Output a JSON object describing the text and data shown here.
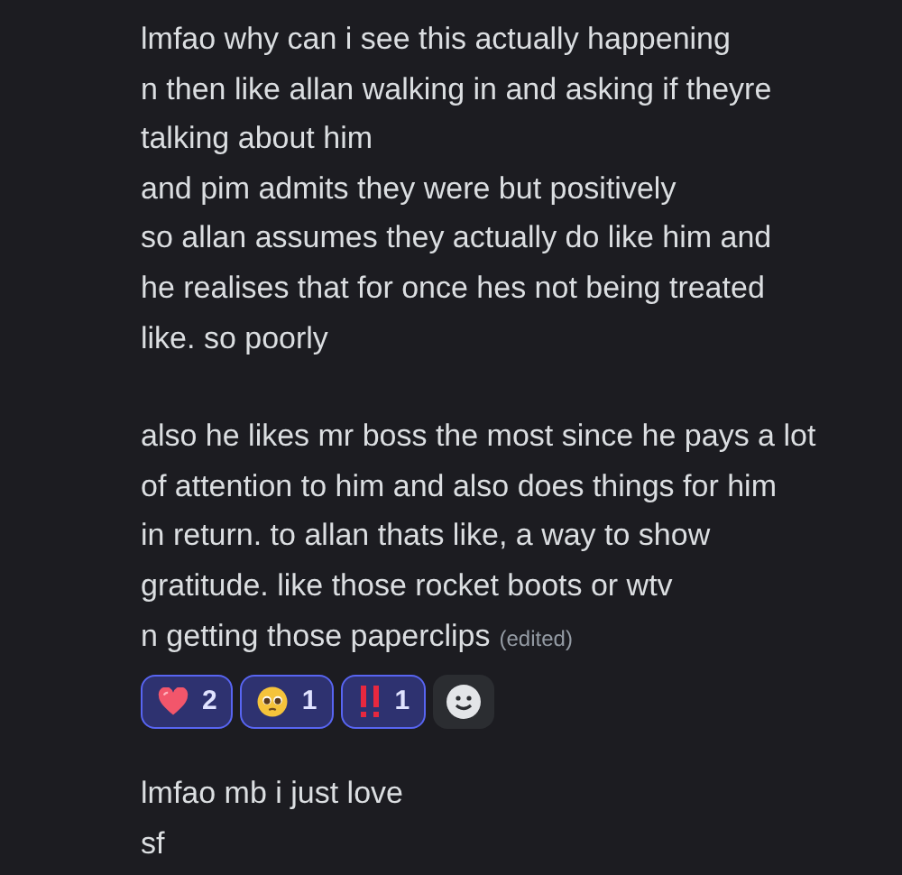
{
  "messages": [
    {
      "paragraphs": [
        [
          "lmfao why can i see this actually happening",
          "n then like allan walking in and asking if theyre",
          "talking about him",
          "and pim admits they were but positively",
          "so allan assumes they actually do like him and",
          "he realises that for once hes not being treated",
          "like. so poorly"
        ],
        [
          "also he likes mr boss the most since he pays a lot",
          "of attention to him and also does things for him",
          "in return. to allan thats like, a way to show",
          "gratitude. like those rocket boots or wtv",
          "n getting those paperclips"
        ]
      ],
      "edited": "(edited)",
      "reactions": [
        {
          "kind": "heart",
          "count": "2",
          "selected": true
        },
        {
          "kind": "pleading",
          "count": "1",
          "selected": true
        },
        {
          "kind": "exclamation",
          "count": "1",
          "selected": true
        }
      ]
    },
    {
      "paragraphs": [
        [
          "lmfao mb i just love",
          "sf"
        ]
      ]
    }
  ]
}
